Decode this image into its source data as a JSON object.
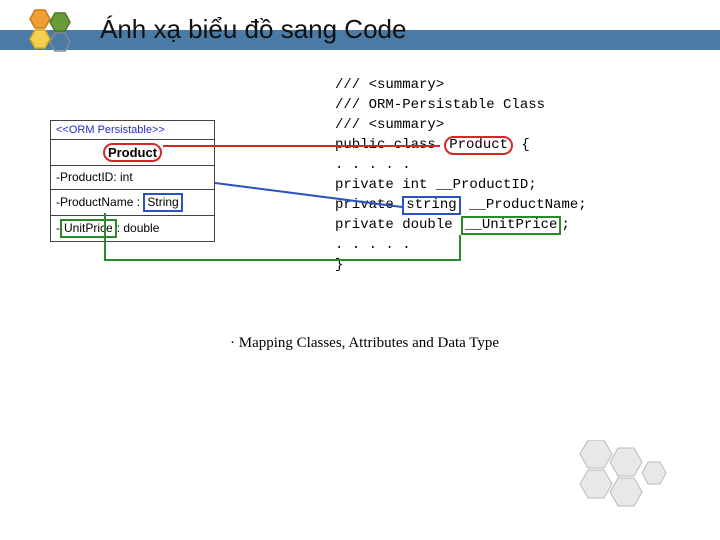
{
  "title": "Ánh xạ biểu đồ sang Code",
  "uml": {
    "stereotype": "<<ORM Persistable>>",
    "className": "Product",
    "attr1_prefix": "-ProductID: int",
    "attr2_prefix": "-ProductName : ",
    "attr2_type": "String",
    "attr3_name": "UnitPrice",
    "attr3_suffix": ": double"
  },
  "code": {
    "l1": "/// <summary>",
    "l2": "/// ORM-Persistable Class",
    "l3": "/// <summary>",
    "l4a": "public class ",
    "l4b": "Product",
    "l4c": " {",
    "l5": ". . . . .",
    "l6": "private int __ProductID;",
    "l7a": "private ",
    "l7b": "string",
    "l7c": " __ProductName;",
    "l8a": "private double ",
    "l8b": "__UnitPrice",
    "l8c": ";",
    "l9": ". . . . .",
    "l10": "}"
  },
  "caption_prefix": "· ",
  "caption_text": "Mapping Classes, Attributes and Data Type"
}
